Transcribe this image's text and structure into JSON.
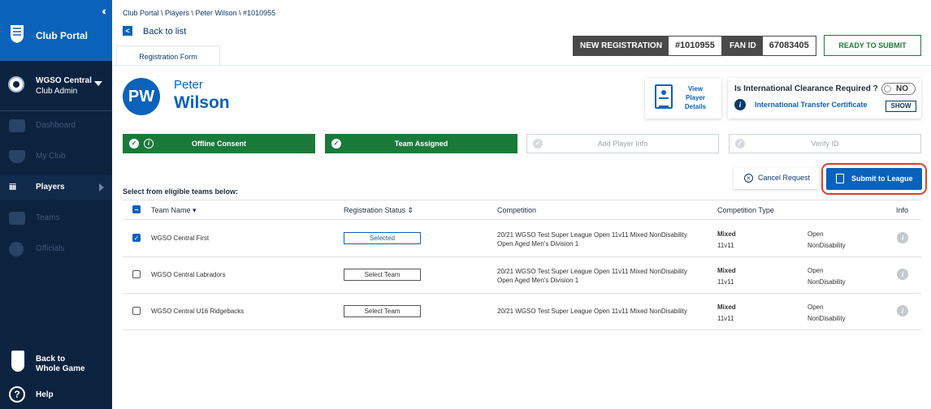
{
  "sidebar": {
    "collapse_icon": "double-chevron-left-icon",
    "title": "Club Portal",
    "club": {
      "name": "WGSO Central",
      "role": "Club Admin"
    },
    "items": [
      {
        "label": "Dashboard",
        "icon": "dashboard-icon"
      },
      {
        "label": "My Club",
        "icon": "shield-icon"
      },
      {
        "label": "Players",
        "icon": "players-icon",
        "active": true
      },
      {
        "label": "Teams",
        "icon": "teams-icon"
      },
      {
        "label": "Officials",
        "icon": "officials-icon"
      }
    ],
    "back_game": {
      "line1": "Back to",
      "line2": "Whole Game"
    },
    "help": "Help"
  },
  "breadcrumb": "Club Portal \\ Players \\ Peter Wilson \\ #1010955",
  "back_label": "Back to list",
  "tab_label": "Registration Form",
  "new_registration": {
    "key": "NEW REGISTRATION",
    "value": "#1010955"
  },
  "fan_id": {
    "key": "FAN ID",
    "value": "67083405"
  },
  "ready_label": "READY TO SUBMIT",
  "player": {
    "initials": "PW",
    "first": "Peter",
    "last": "Wilson"
  },
  "view_details": "View Player Details",
  "clearance": {
    "question": "Is International Clearance Required ?",
    "toggle": "NO",
    "link": "International Transfer Certificate",
    "show": "SHOW"
  },
  "steps": [
    {
      "label": "Offline Consent",
      "done": true
    },
    {
      "label": "Team Assigned",
      "done": true
    },
    {
      "label": "Add Player Info",
      "done": false
    },
    {
      "label": "Verify ID",
      "done": false
    }
  ],
  "cancel_label": "Cancel Request",
  "submit_label": "Submit to League",
  "select_label": "Select from eligible teams below:",
  "table": {
    "headers": [
      "Team Name",
      "Registration Status",
      "Competition",
      "Competition Type",
      "Info"
    ],
    "rows": [
      {
        "checked": true,
        "team": "WGSO Central First",
        "status": "Selected",
        "comp1": "20/21 WGSO Test Super League Open 11v11 Mixed NonDisability",
        "comp2": "Open Aged Men's Division 1",
        "type1": "Mixed",
        "type2": "11v11",
        "open1": "Open",
        "open2": "NonDisability"
      },
      {
        "checked": false,
        "team": "WGSO Central Labradors",
        "status": "Select Team",
        "comp1": "20/21 WGSO Test Super League Open 11v11 Mixed NonDisability",
        "comp2": "Open Aged Men's Division 1",
        "type1": "Mixed",
        "type2": "11v11",
        "open1": "Open",
        "open2": "NonDisability"
      },
      {
        "checked": false,
        "team": "WGSO Central U16 Ridgebacks",
        "status": "Select Team",
        "comp1": "20/21 WGSO Test Super League Open 11v11 Mixed NonDisability",
        "comp2": "",
        "type1": "Mixed",
        "type2": "11v11",
        "open1": "Open",
        "open2": "NonDisability"
      }
    ]
  },
  "colors": {
    "primary": "#0a62ba",
    "navy": "#0c2340",
    "success": "#1a7a3a",
    "highlight": "#d9412f"
  }
}
